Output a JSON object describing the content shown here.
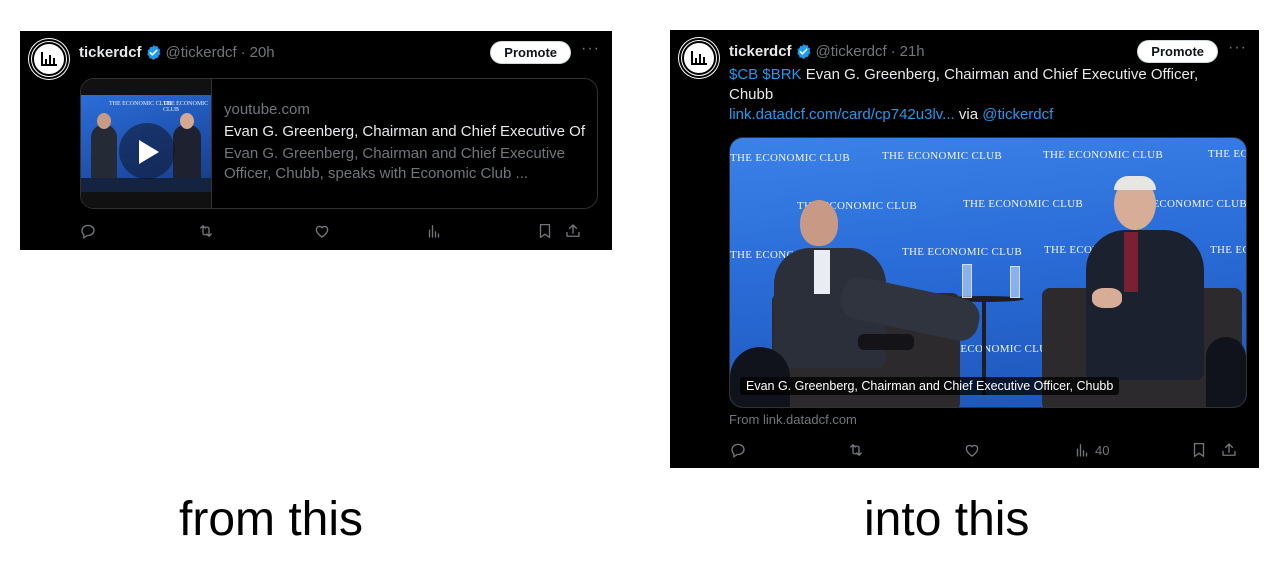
{
  "left": {
    "author_name": "tickerdcf",
    "handle": "@tickerdcf",
    "time": "20h",
    "promote_label": "Promote",
    "more_label": "···",
    "card": {
      "domain": "youtube.com",
      "title": "Evan G. Greenberg, Chairman and Chief Executive Of",
      "description": "Evan G. Greenberg, Chairman and Chief Executive Officer, Chubb, speaks with Economic Club ..."
    }
  },
  "right": {
    "author_name": "tickerdcf",
    "handle": "@tickerdcf",
    "time": "21h",
    "promote_label": "Promote",
    "more_label": "···",
    "text": {
      "cashtags": "$CB $BRK",
      "body": "Evan G. Greenberg, Chairman and Chief Executive Officer, Chubb",
      "link": "link.datadcf.com/card/cp742u3lv...",
      "via": "via",
      "mention": "@tickerdcf"
    },
    "media": {
      "caption": "Evan G. Greenberg, Chairman and Chief Executive Officer, Chubb",
      "logo_text": "THE ECONOMIC CLUB"
    },
    "from_label": "From link.datadcf.com",
    "views_count": "40"
  },
  "labels": {
    "from": "from this",
    "into": "into this"
  },
  "colors": {
    "background": "#000000",
    "text": "#e7e9ea",
    "muted": "#71767b",
    "link": "#1d9bf0",
    "verified": "#1d9bf0",
    "border": "#2f3336"
  }
}
